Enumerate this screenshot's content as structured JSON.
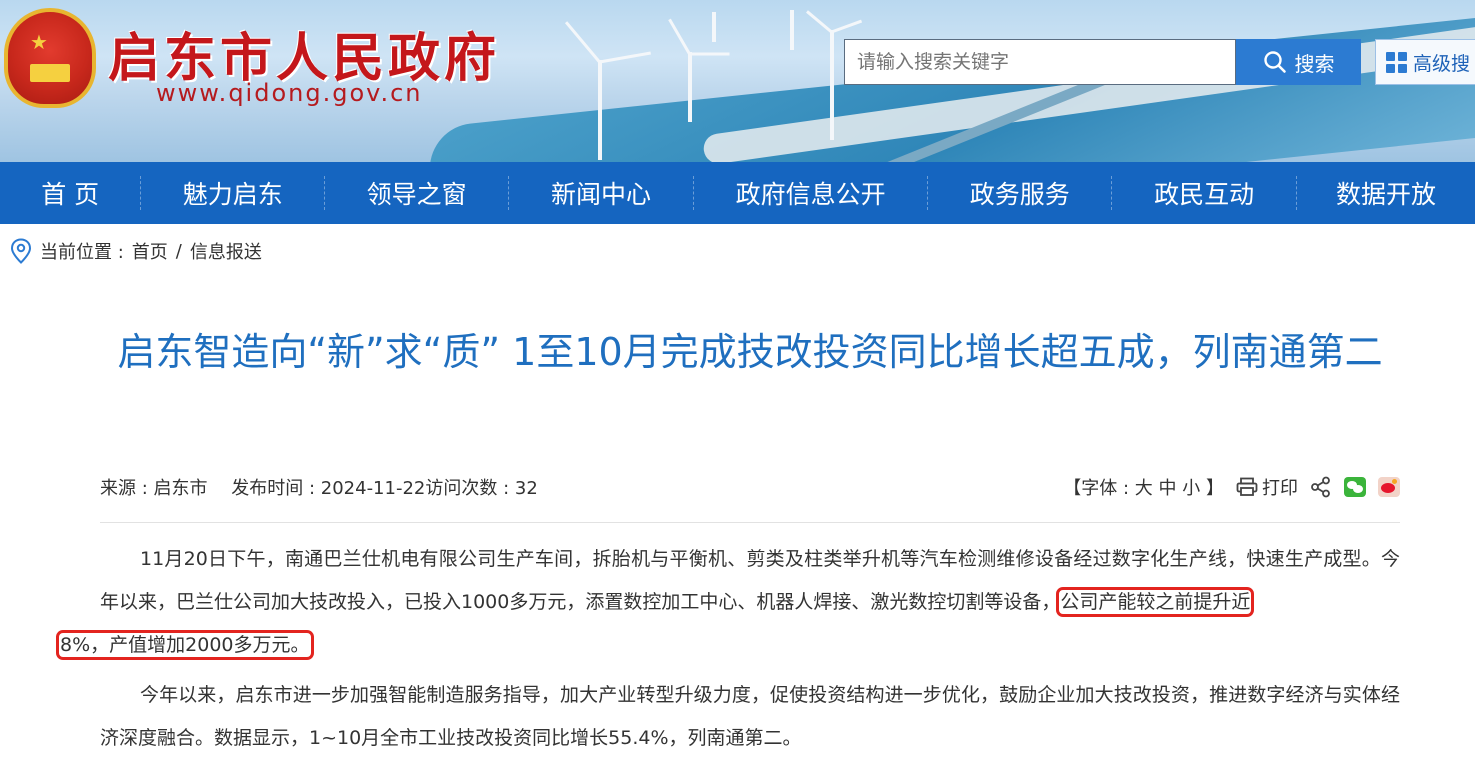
{
  "header": {
    "site_title": "启东市人民政府",
    "site_url": "www.qidong.gov.cn",
    "search": {
      "placeholder": "请输入搜索关键字",
      "button_label": "搜索",
      "advanced_label": "高级搜"
    }
  },
  "nav": {
    "items": [
      {
        "label": "首 页"
      },
      {
        "label": "魅力启东"
      },
      {
        "label": "领导之窗"
      },
      {
        "label": "新闻中心"
      },
      {
        "label": "政府信息公开"
      },
      {
        "label": "政务服务"
      },
      {
        "label": "政民互动"
      },
      {
        "label": "数据开放"
      }
    ]
  },
  "breadcrumb": {
    "prefix": "当前位置 :",
    "home": "首页",
    "separator": "/",
    "current": "信息报送"
  },
  "article": {
    "title": "启东智造向“新”求“质” 1至10月完成技改投资同比增长超五成，列南通第二",
    "meta": {
      "source": "来源 : 启东市",
      "date": "发布时间 : 2024-11-22",
      "visits": "访问次数 : 32",
      "font_open": "【字体 :",
      "font_large": "大",
      "font_medium": "中",
      "font_small": "小",
      "font_close": "】",
      "print_label": "打印"
    },
    "para1_a": "11月20日下午，南通巴兰仕机电有限公司生产车间，拆胎机与平衡机、剪类及柱类举升机等汽车检测维修设备经过数字化生产线，快速生产成型。今年以来，巴兰仕公司加大技改投入，已投入1000多万元，添置数控加工中心、机器人焊接、激光数控切割等设备，",
    "para1_hl1": "公司产能较之前提升近",
    "para1_hl2": "8%，产值增加2000多万元。",
    "para2": "今年以来，启东市进一步加强智能制造服务指导，加大产业转型升级力度，促使投资结构进一步优化，鼓励企业加大技改投资，推进数字经济与实体经济深度融合。数据显示，1~10月全市工业技改投资同比增长55.4%，列南通第二。"
  },
  "colors": {
    "brand_red": "#c4171b",
    "nav_blue": "#1565c0",
    "title_blue": "#1f6fbf",
    "highlight_red": "#e3241f"
  }
}
